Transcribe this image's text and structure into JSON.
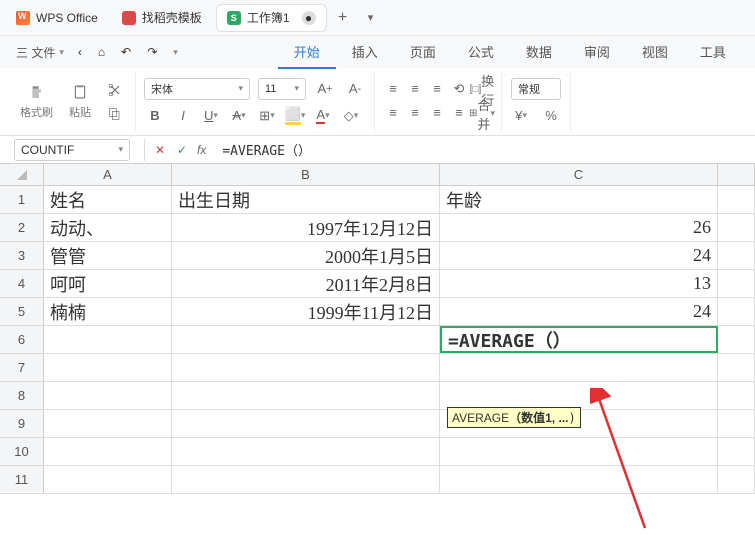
{
  "title": {
    "app": "WPS Office",
    "template_tab": "找稻壳模板",
    "sheet_tab": "工作簿1",
    "sheet_icon": "S"
  },
  "menu": {
    "file": "三 文件",
    "back_icon": "‹",
    "home_icon": "⌂",
    "undo_icon": "↶",
    "redo_icon": "↷",
    "tabs": [
      "开始",
      "插入",
      "页面",
      "公式",
      "数据",
      "审阅",
      "视图",
      "工具"
    ]
  },
  "toolbar": {
    "format_painter": "格式刷",
    "paste": "粘贴",
    "font": "宋体",
    "size": "11",
    "general": "常规",
    "wrap": "换行",
    "merge": "合并"
  },
  "formula_bar": {
    "name_box": "COUNTIF",
    "formula": "=AVERAGE（）"
  },
  "columns": [
    "A",
    "B",
    "C"
  ],
  "rows": [
    "1",
    "2",
    "3",
    "4",
    "5",
    "6",
    "7",
    "8",
    "9",
    "10",
    "11"
  ],
  "cells": {
    "r1": {
      "a": "姓名",
      "b": "出生日期",
      "c": "年龄"
    },
    "r2": {
      "a": "动动、",
      "b": "1997年12月12日",
      "c": "26"
    },
    "r3": {
      "a": "管管",
      "b": "2000年1月5日",
      "c": "24"
    },
    "r4": {
      "a": "呵呵",
      "b": "2011年2月8日",
      "c": "13"
    },
    "r5": {
      "a": "楠楠",
      "b": "1999年11月12日",
      "c": "24"
    },
    "r6": {
      "c_formula": "=AVERAGE（）"
    }
  },
  "tooltip": {
    "fn": "AVERAGE",
    "args": "（数值1, ..."
  }
}
